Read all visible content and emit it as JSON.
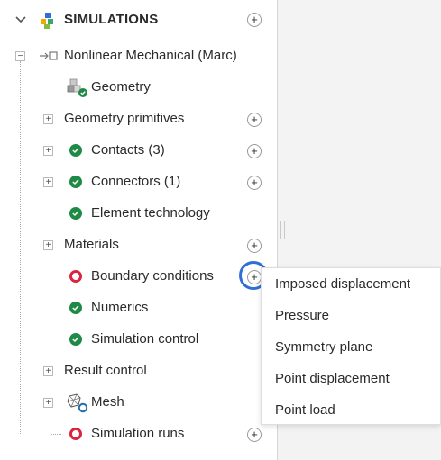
{
  "header": {
    "title": "SIMULATIONS"
  },
  "tree": {
    "root": "Nonlinear Mechanical (Marc)",
    "items": [
      {
        "label": "Geometry",
        "status": "geometry-ok"
      },
      {
        "label": "Geometry primitives",
        "status": "none"
      },
      {
        "label": "Contacts (3)",
        "status": "ok"
      },
      {
        "label": "Connectors (1)",
        "status": "ok"
      },
      {
        "label": "Element technology",
        "status": "ok"
      },
      {
        "label": "Materials",
        "status": "none"
      },
      {
        "label": "Boundary conditions",
        "status": "error"
      },
      {
        "label": "Numerics",
        "status": "ok"
      },
      {
        "label": "Simulation control",
        "status": "ok"
      },
      {
        "label": "Result control",
        "status": "none"
      },
      {
        "label": "Mesh",
        "status": "mesh-pending"
      },
      {
        "label": "Simulation runs",
        "status": "error"
      }
    ]
  },
  "menu": {
    "items": [
      "Imposed displacement",
      "Pressure",
      "Symmetry plane",
      "Point displacement",
      "Point load"
    ]
  },
  "colors": {
    "ok": "#1f8a45",
    "error": "#d7263d",
    "focus": "#2f6fd6"
  }
}
